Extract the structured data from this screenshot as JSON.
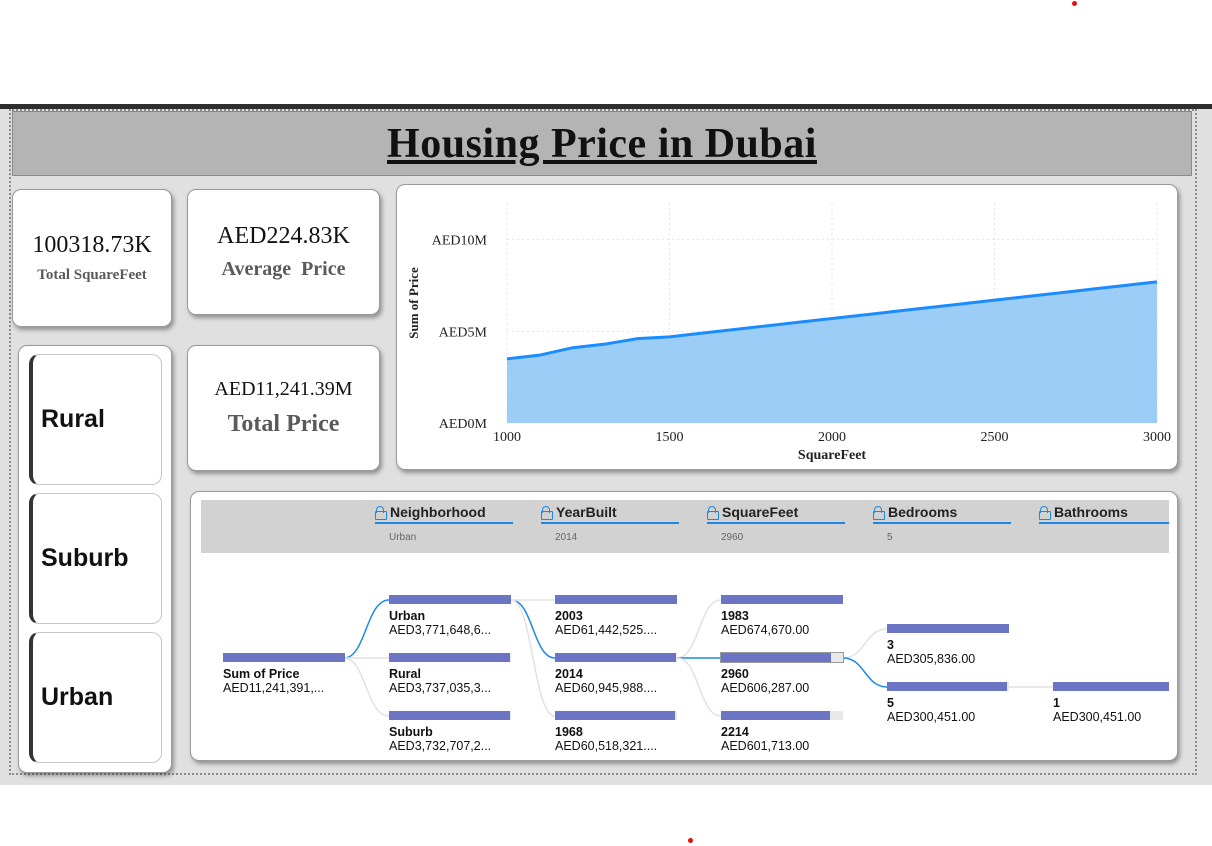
{
  "dashboard": {
    "title": "Housing Price in Dubai"
  },
  "kpis": {
    "total_squarefeet": {
      "value": "100318.73K",
      "label": "Total SquareFeet"
    },
    "average_price": {
      "value": "AED224.83K",
      "label": "Average  Price"
    },
    "total_price": {
      "value": "AED11,241.39M",
      "label": "Total Price"
    }
  },
  "slicer": {
    "items": [
      "Rural",
      "Suburb",
      "Urban"
    ]
  },
  "chart_data": {
    "type": "area",
    "title": "",
    "xlabel": "SquareFeet",
    "ylabel": "Sum of Price",
    "xlim": [
      1000,
      3000
    ],
    "ylim": [
      0,
      12000000
    ],
    "x_ticks": [
      "1000",
      "1500",
      "2000",
      "2500",
      "3000"
    ],
    "y_ticks": [
      "AED0M",
      "AED5M",
      "AED10M"
    ],
    "grid": true,
    "color": "#1a8cff",
    "fill_color": "#9ccdf7",
    "series": [
      {
        "x": [
          1000,
          1100,
          1200,
          1300,
          1400,
          1500,
          1600,
          1700,
          1800,
          1900,
          2000,
          2100,
          2200,
          2300,
          2400,
          2500,
          2600,
          2700,
          2800,
          2900,
          3000
        ],
        "y": [
          3500000,
          3700000,
          4100000,
          4300000,
          4600000,
          4700000,
          4900000,
          5100000,
          5300000,
          5500000,
          5700000,
          5900000,
          6100000,
          6300000,
          6500000,
          6700000,
          6900000,
          7100000,
          7300000,
          7500000,
          7700000
        ]
      }
    ]
  },
  "decomposition_tree": {
    "levels": [
      {
        "name": "Neighborhood",
        "selected": "Urban"
      },
      {
        "name": "YearBuilt",
        "selected": "2014"
      },
      {
        "name": "SquareFeet",
        "selected": "2960"
      },
      {
        "name": "Bedrooms",
        "selected": "5"
      },
      {
        "name": "Bathrooms",
        "selected": ""
      }
    ],
    "root": {
      "label": "Sum of Price",
      "value": "AED11,241,391,..."
    },
    "neighborhood": [
      {
        "label": "Urban",
        "value": "AED3,771,648,6...",
        "share": 1.0
      },
      {
        "label": "Rural",
        "value": "AED3,737,035,3...",
        "share": 0.99
      },
      {
        "label": "Suburb",
        "value": "AED3,732,707,2...",
        "share": 0.99
      }
    ],
    "yearbuilt": [
      {
        "label": "2003",
        "value": "AED61,442,525....",
        "share": 1.0
      },
      {
        "label": "2014",
        "value": "AED60,945,988....",
        "share": 0.99
      },
      {
        "label": "1968",
        "value": "AED60,518,321....",
        "share": 0.98
      }
    ],
    "squarefeet": [
      {
        "label": "1983",
        "value": "AED674,670.00",
        "share": 1.0
      },
      {
        "label": "2960",
        "value": "AED606,287.00",
        "share": 0.9
      },
      {
        "label": "2214",
        "value": "AED601,713.00",
        "share": 0.89
      }
    ],
    "bedrooms": [
      {
        "label": "3",
        "value": "AED305,836.00",
        "share": 1.0
      },
      {
        "label": "5",
        "value": "AED300,451.00",
        "share": 0.98
      }
    ],
    "bathrooms": [
      {
        "label": "1",
        "value": "AED300,451.00",
        "share": 1.0
      }
    ]
  }
}
